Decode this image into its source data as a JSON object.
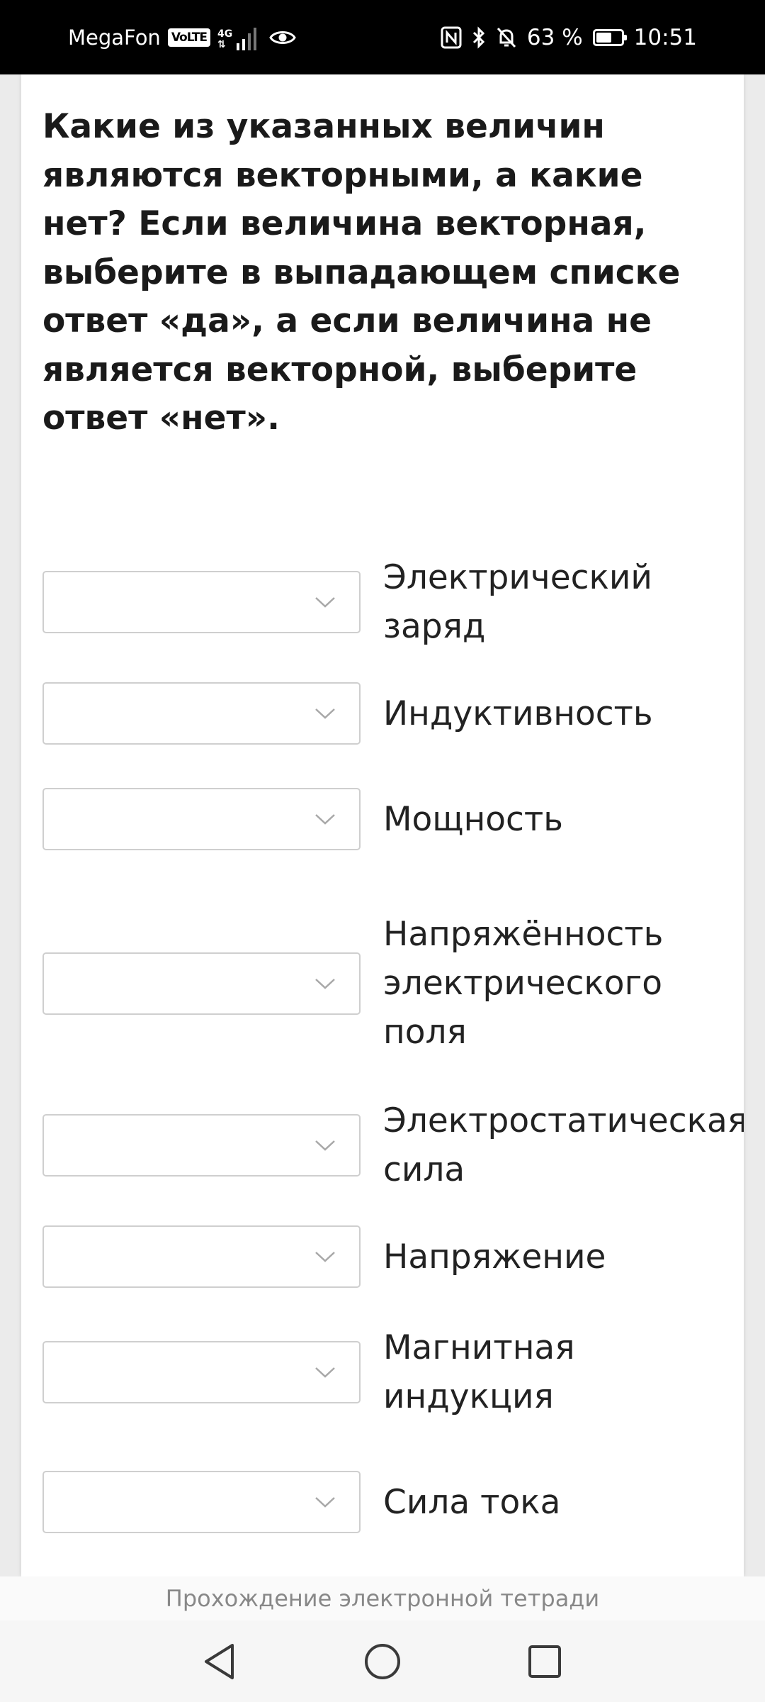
{
  "status_bar": {
    "carrier": "MegaFon",
    "volte": "VoLTE",
    "network": "4G",
    "battery_percent": "63 %",
    "battery_level": 0.63,
    "time": "10:51"
  },
  "question": "Какие из указанных величин являются векторными, а какие нет? Если величина векторная, выберите в выпадающем списке ответ «да», а если величина не является векторной, выберите ответ «нет».",
  "rows": [
    {
      "label": "Электрический заряд",
      "value": ""
    },
    {
      "label": "Индуктивность",
      "value": ""
    },
    {
      "label": "Мощность",
      "value": ""
    },
    {
      "label": "Напряжённость электрического поля",
      "value": ""
    },
    {
      "label": "Электростатическая сила",
      "value": ""
    },
    {
      "label": "Напряжение",
      "value": ""
    },
    {
      "label": "Магнитная индукция",
      "value": ""
    },
    {
      "label": "Сила тока",
      "value": ""
    }
  ],
  "footer": {
    "title": "Прохождение электронной тетради"
  },
  "icons": {
    "select_arrow": "chevron-down-icon",
    "nav_back": "back-triangle-icon",
    "nav_home": "home-circle-icon",
    "nav_recents": "recents-square-icon"
  }
}
